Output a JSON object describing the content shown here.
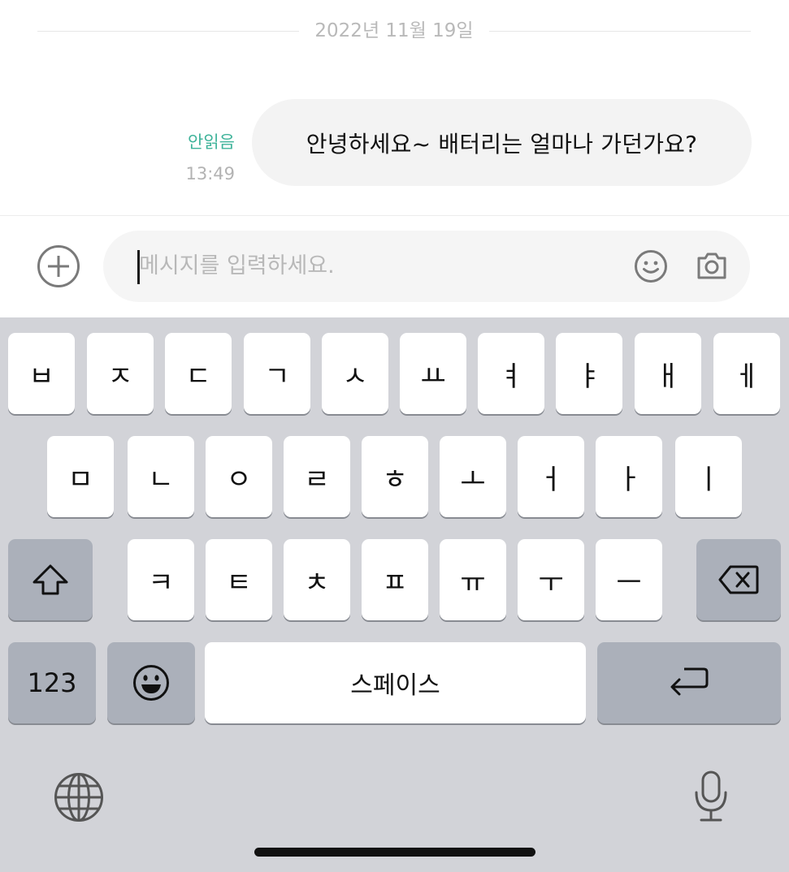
{
  "chat": {
    "date": "2022년 11월 19일",
    "message": {
      "text": "안녕하세요~ 배터리는 얼마나 가던가요?",
      "read_status": "안읽음",
      "time": "13:49"
    }
  },
  "input": {
    "placeholder": "메시지를 입력하세요.",
    "icons": [
      "plus-icon",
      "emoji-icon",
      "camera-icon"
    ]
  },
  "keyboard": {
    "row1": [
      "ㅂ",
      "ㅈ",
      "ㄷ",
      "ㄱ",
      "ㅅ",
      "ㅛ",
      "ㅕ",
      "ㅑ",
      "ㅐ",
      "ㅔ"
    ],
    "row2": [
      "ㅁ",
      "ㄴ",
      "ㅇ",
      "ㄹ",
      "ㅎ",
      "ㅗ",
      "ㅓ",
      "ㅏ",
      "ㅣ"
    ],
    "row3": [
      "ㅋ",
      "ㅌ",
      "ㅊ",
      "ㅍ",
      "ㅠ",
      "ㅜ",
      "ㅡ"
    ],
    "numbers_label": "123",
    "space_label": "스페이스",
    "icons": [
      "shift-icon",
      "backspace-icon",
      "emoji-keyboard-icon",
      "return-icon",
      "globe-icon",
      "microphone-icon"
    ]
  },
  "colors": {
    "read_status": "#3fb39a",
    "keyboard_bg": "#d2d3d8",
    "function_key": "#abb0ba"
  }
}
